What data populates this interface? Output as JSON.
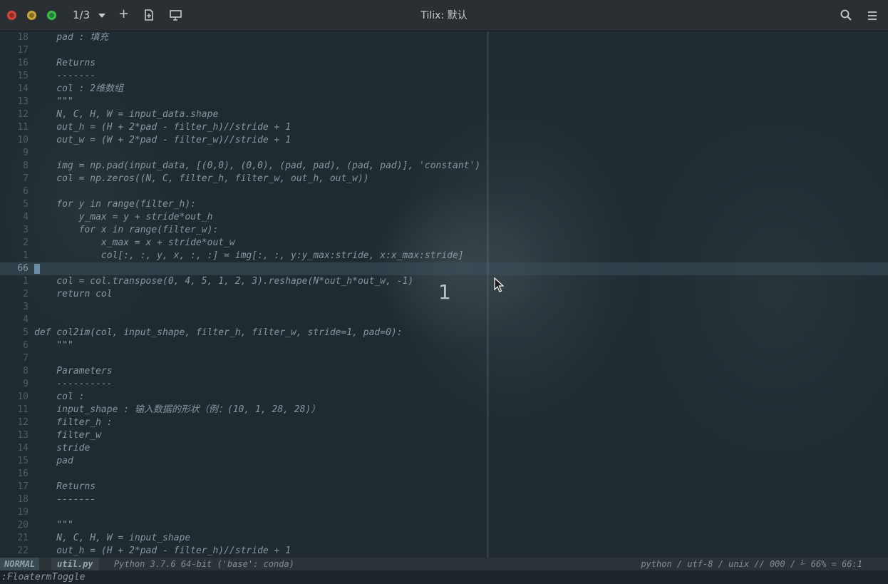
{
  "titlebar": {
    "window_title": "Tilix: 默认",
    "session_indicator": "1/3",
    "add_label": "+"
  },
  "editor": {
    "lines": [
      {
        "num": "18",
        "text": "    pad : 填充"
      },
      {
        "num": "17",
        "text": ""
      },
      {
        "num": "16",
        "text": "    Returns"
      },
      {
        "num": "15",
        "text": "    -------"
      },
      {
        "num": "14",
        "text": "    col : 2维数组"
      },
      {
        "num": "13",
        "text": "    \"\"\""
      },
      {
        "num": "12",
        "text": "    N, C, H, W = input_data.shape"
      },
      {
        "num": "11",
        "text": "    out_h = (H + 2*pad - filter_h)//stride + 1"
      },
      {
        "num": "10",
        "text": "    out_w = (W + 2*pad - filter_w)//stride + 1"
      },
      {
        "num": "9",
        "text": ""
      },
      {
        "num": "8",
        "text": "    img = np.pad(input_data, [(0,0), (0,0), (pad, pad), (pad, pad)], 'constant')"
      },
      {
        "num": "7",
        "text": "    col = np.zeros((N, C, filter_h, filter_w, out_h, out_w))"
      },
      {
        "num": "6",
        "text": ""
      },
      {
        "num": "5",
        "text": "    for y in range(filter_h):"
      },
      {
        "num": "4",
        "text": "        y_max = y + stride*out_h"
      },
      {
        "num": "3",
        "text": "        for x in range(filter_w):"
      },
      {
        "num": "2",
        "text": "            x_max = x + stride*out_w"
      },
      {
        "num": "1",
        "text": "            col[:, :, y, x, :, :] = img[:, :, y:y_max:stride, x:x_max:stride]"
      },
      {
        "num": "66",
        "text": "",
        "current": true
      },
      {
        "num": "1",
        "text": "    col = col.transpose(0, 4, 5, 1, 2, 3).reshape(N*out_h*out_w, -1)"
      },
      {
        "num": "2",
        "text": "    return col"
      },
      {
        "num": "3",
        "text": ""
      },
      {
        "num": "4",
        "text": ""
      },
      {
        "num": "5",
        "text": "def col2im(col, input_shape, filter_h, filter_w, stride=1, pad=0):"
      },
      {
        "num": "6",
        "text": "    \"\"\""
      },
      {
        "num": "7",
        "text": ""
      },
      {
        "num": "8",
        "text": "    Parameters"
      },
      {
        "num": "9",
        "text": "    ----------"
      },
      {
        "num": "10",
        "text": "    col :"
      },
      {
        "num": "11",
        "text": "    input_shape : 输入数据的形状（例：(10, 1, 28, 28)）"
      },
      {
        "num": "12",
        "text": "    filter_h :"
      },
      {
        "num": "13",
        "text": "    filter_w"
      },
      {
        "num": "14",
        "text": "    stride"
      },
      {
        "num": "15",
        "text": "    pad"
      },
      {
        "num": "16",
        "text": ""
      },
      {
        "num": "17",
        "text": "    Returns"
      },
      {
        "num": "18",
        "text": "    -------"
      },
      {
        "num": "19",
        "text": ""
      },
      {
        "num": "20",
        "text": "    \"\"\""
      },
      {
        "num": "21",
        "text": "    N, C, H, W = input_shape"
      },
      {
        "num": "22",
        "text": "    out_h = (H + 2*pad - filter_h)//stride + 1"
      }
    ],
    "overlay_number": "1"
  },
  "statusline": {
    "mode": "NORMAL",
    "filename": "util.py",
    "environment": "Python 3.7.6 64-bit ('base': conda)",
    "right_info": "python / utf-8 / unix // 000 / ⅟ 66% = 66:1"
  },
  "cmdline": {
    "text": ":FloatermToggle"
  }
}
